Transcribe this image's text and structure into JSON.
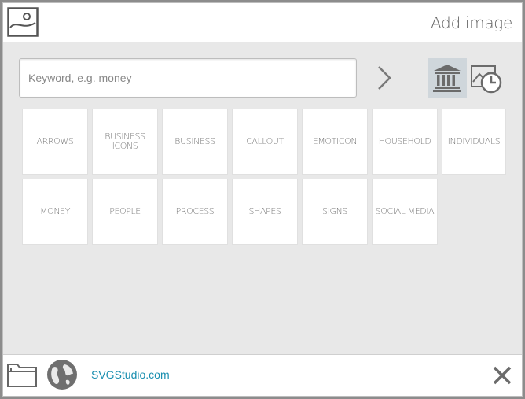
{
  "header": {
    "title": "Add image",
    "logo_icon": "image-icon"
  },
  "search": {
    "placeholder": "Keyword, e.g. money",
    "value": "",
    "go_icon": "chevron-right-icon",
    "library_icon": "library-icon",
    "recent_icon": "recent-images-icon"
  },
  "categories": [
    {
      "label": "ARROWS"
    },
    {
      "label": "BUSINESS ICONS"
    },
    {
      "label": "BUSINESS"
    },
    {
      "label": "CALLOUT"
    },
    {
      "label": "EMOTICON"
    },
    {
      "label": "HOUSEHOLD"
    },
    {
      "label": "INDIVIDUALS"
    },
    {
      "label": "MONEY"
    },
    {
      "label": "PEOPLE"
    },
    {
      "label": "PROCESS"
    },
    {
      "label": "SHAPES"
    },
    {
      "label": "SIGNS"
    },
    {
      "label": "SOCIAL MEDIA"
    }
  ],
  "footer": {
    "folder_icon": "folder-icon",
    "globe_icon": "globe-icon",
    "link_text": "SVGStudio.com",
    "close_icon": "close-icon"
  },
  "colors": {
    "accent_link": "#1a8fb0",
    "selected_tab_bg": "#cfd6db",
    "panel_bg": "#e8e8e8"
  }
}
